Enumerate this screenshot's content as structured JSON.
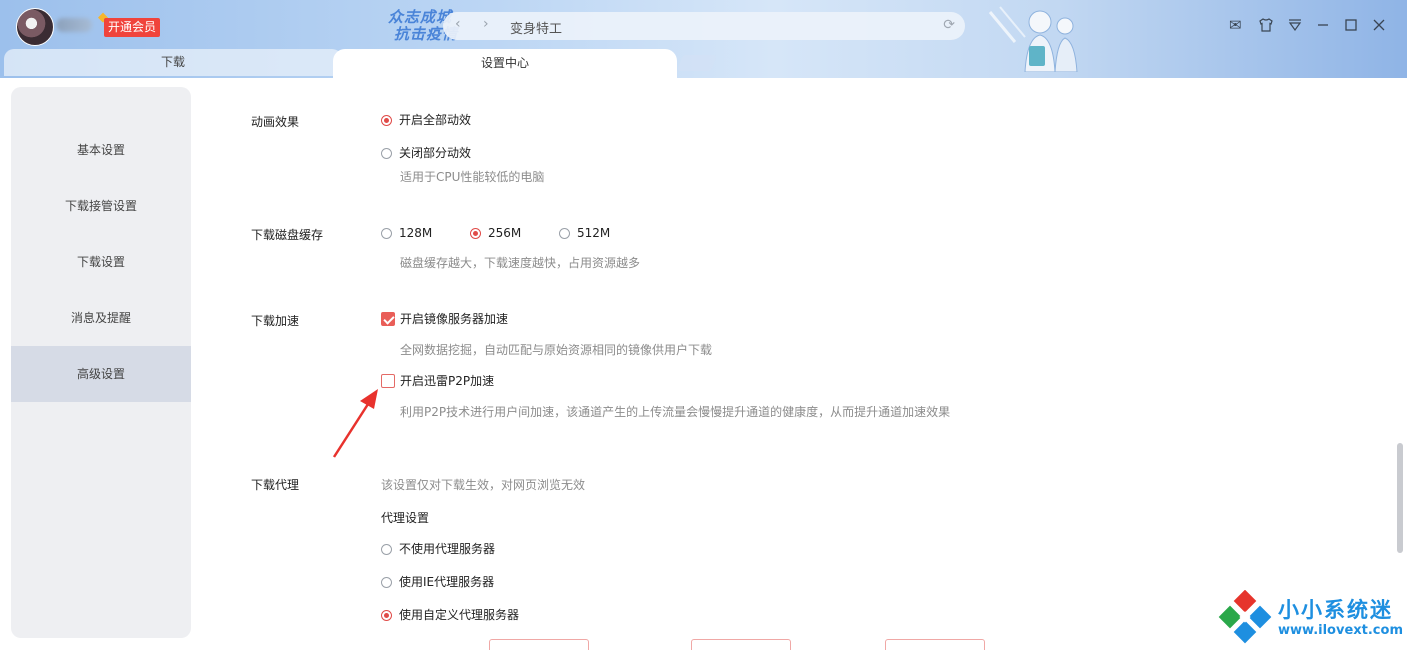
{
  "titlebar": {
    "vip_label": "开通会员",
    "slogan_line1": "众志成城",
    "slogan_line2": "抗击疫情",
    "address_text": "变身特工",
    "back_glyph": "‹",
    "forward_glyph": "›",
    "refresh_glyph": "⟳",
    "icons": [
      "mail-icon",
      "shirt-icon",
      "dropdown-menu-icon",
      "minimize-icon",
      "maximize-icon",
      "close-icon"
    ],
    "close_glyph": "✕",
    "min_glyph": "—",
    "max_glyph": "☐",
    "menu_glyph": "▽",
    "mail_glyph": "✉",
    "shirt_glyph": "👕"
  },
  "tabs": [
    {
      "label": "下载"
    },
    {
      "label": "设置中心"
    }
  ],
  "sidebar": {
    "items": [
      {
        "label": "基本设置"
      },
      {
        "label": "下载接管设置"
      },
      {
        "label": "下载设置"
      },
      {
        "label": "消息及提醒"
      },
      {
        "label": "高级设置",
        "active": true
      }
    ]
  },
  "settings": {
    "animation": {
      "label": "动画效果",
      "option_all": "开启全部动效",
      "option_partial": "关闭部分动效",
      "option_partial_hint": "适用于CPU性能较低的电脑",
      "selected": "开启全部动效"
    },
    "disk_cache": {
      "label": "下载磁盘缓存",
      "options": [
        "128M",
        "256M",
        "512M"
      ],
      "selected": "256M",
      "hint": "磁盘缓存越大，下载速度越快，占用资源越多"
    },
    "acceleration": {
      "label": "下载加速",
      "mirror_label": "开启镜像服务器加速",
      "mirror_checked": true,
      "mirror_hint": "全网数据挖掘，自动匹配与原始资源相同的镜像供用户下载",
      "p2p_label": "开启迅雷P2P加速",
      "p2p_checked": false,
      "p2p_hint": "利用P2P技术进行用户间加速，该通道产生的上传流量会慢慢提升通道的健康度，从而提升通道加速效果"
    },
    "proxy": {
      "label": "下载代理",
      "hint": "该设置仅对下载生效，对网页浏览无效",
      "subheading": "代理设置",
      "option_none": "不使用代理服务器",
      "option_ie": "使用IE代理服务器",
      "option_custom": "使用自定义代理服务器",
      "selected": "使用自定义代理服务器"
    }
  },
  "watermark": {
    "name": "小小系统迷",
    "url": "www.ilovext.com"
  },
  "colors": {
    "accent": "#e95e58",
    "vip": "#f0443c",
    "watermark": "#1e8fe0"
  }
}
